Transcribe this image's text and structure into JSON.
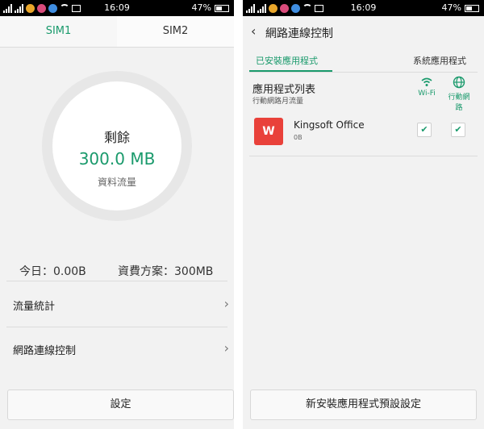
{
  "status_left": {
    "time": "16:09",
    "battery": "47%"
  },
  "status_right": {
    "time": "16:09",
    "battery": "47%"
  },
  "left": {
    "tabs": [
      "SIM1",
      "SIM2"
    ],
    "remaining_label": "剩餘",
    "remaining_value": "300.0 MB",
    "remaining_sub": "資料流量",
    "today": "今日：0.00B",
    "plan": "資費方案：300MB",
    "rows": [
      "流量統計",
      "網路連線控制"
    ],
    "button": "設定"
  },
  "right": {
    "title": "網路連線控制",
    "tabs": [
      "已安裝應用程式",
      "系統應用程式"
    ],
    "list_title": "應用程式列表",
    "list_sub": "行動網路月流量",
    "col_wifi": "Wi-Fi",
    "col_mobile": "行動網路",
    "app": {
      "name": "Kingsoft Office",
      "size": "0B",
      "icon_text": "W"
    },
    "button": "新安裝應用程式預設設定"
  }
}
